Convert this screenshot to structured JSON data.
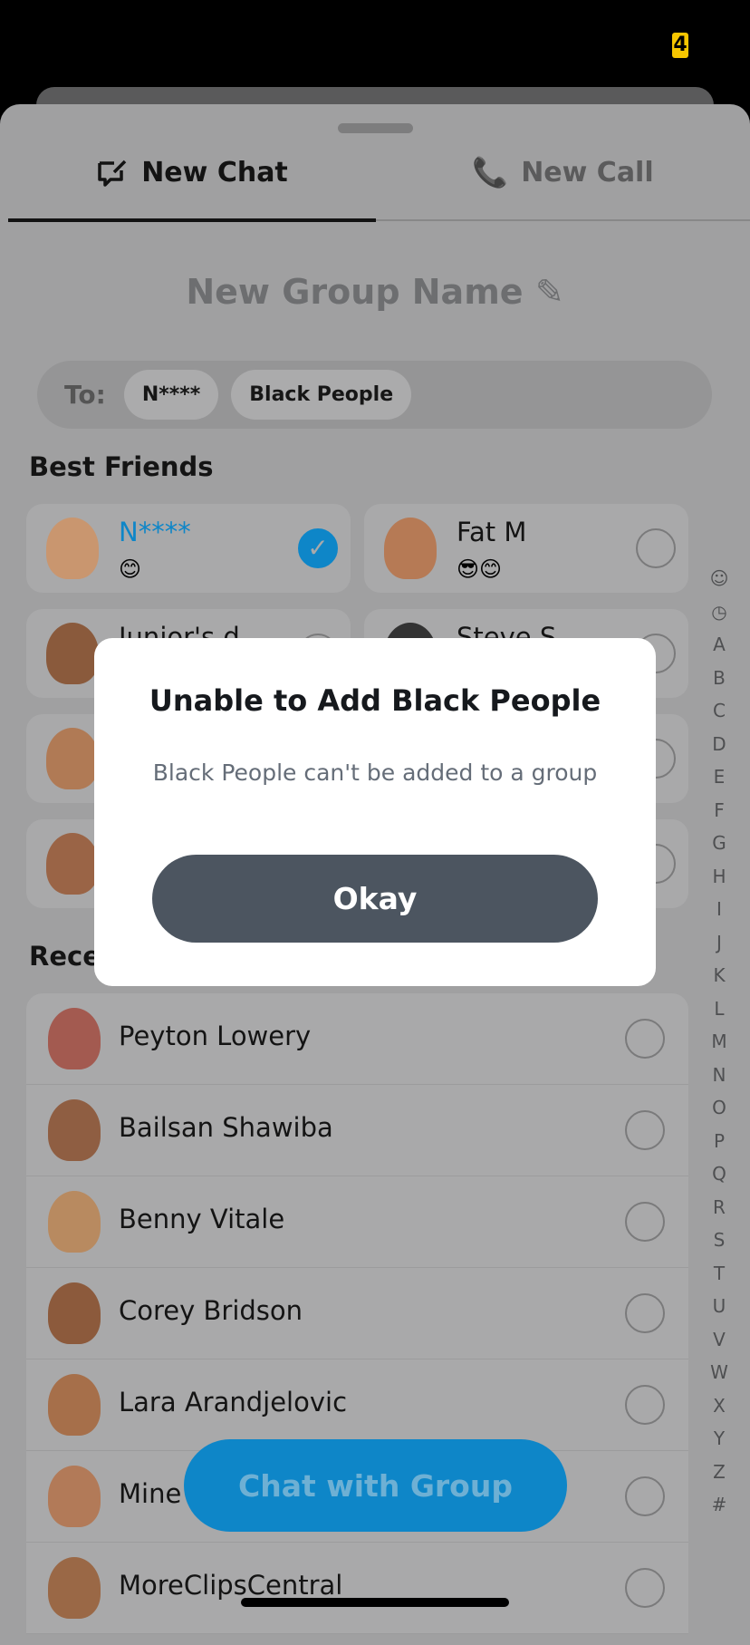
{
  "status_bar": {
    "badge": "4"
  },
  "tabs": [
    {
      "label": "New Chat",
      "icon": "new-chat-icon",
      "active": true
    },
    {
      "label": "New Call",
      "icon": "phone-icon",
      "active": false
    }
  ],
  "group_name": {
    "placeholder": "New Group Name",
    "icon": "pencil-icon"
  },
  "to_bar": {
    "label": "To:",
    "chips": [
      "N****",
      "Black People"
    ]
  },
  "best_friends": {
    "title": "Best Friends",
    "items": [
      {
        "name": "N****",
        "emoji": "😊",
        "selected": true,
        "skin": "#c9966f"
      },
      {
        "name": "Fat M",
        "emoji": "😎😊",
        "selected": false,
        "skin": "#b67a55"
      },
      {
        "name": "Junior's d",
        "emoji": "",
        "selected": false,
        "skin": "#8a5a3c"
      },
      {
        "name": "Steve S",
        "emoji": "",
        "selected": false,
        "skin": "#333"
      },
      {
        "name": "",
        "emoji": "",
        "selected": false,
        "skin": "#b07a55"
      },
      {
        "name": "",
        "emoji": "",
        "selected": false,
        "skin": "#b07a55"
      },
      {
        "name": "",
        "emoji": "",
        "selected": false,
        "skin": "#9a6446"
      },
      {
        "name": "",
        "emoji": "",
        "selected": false,
        "skin": "#b07a55"
      }
    ]
  },
  "recents": {
    "title": "Recents",
    "items": [
      {
        "name": "Peyton Lowery",
        "skin": "#a35a50"
      },
      {
        "name": "Bailsan Shawiba",
        "skin": "#8f5e42"
      },
      {
        "name": "Benny Vitale",
        "skin": "#b88a60"
      },
      {
        "name": "Corey Bridson",
        "skin": "#8c5a3c"
      },
      {
        "name": "Lara Arandjelovic",
        "skin": "#a66f4a"
      },
      {
        "name": "Mine",
        "skin": "#b27a58"
      },
      {
        "name": "MoreClipsCentral",
        "skin": "#9a6846"
      }
    ]
  },
  "alphabet": [
    "☺",
    "◷",
    "A",
    "B",
    "C",
    "D",
    "E",
    "F",
    "G",
    "H",
    "I",
    "J",
    "K",
    "L",
    "M",
    "N",
    "O",
    "P",
    "Q",
    "R",
    "S",
    "T",
    "U",
    "V",
    "W",
    "X",
    "Y",
    "Z",
    "#"
  ],
  "chat_button": "Chat with Group",
  "dialog": {
    "title": "Unable to Add Black People",
    "message": "Black People can't be added to a group",
    "button": "Okay"
  },
  "colors": {
    "accent": "#0e86c8",
    "dialog_button": "#4c5560",
    "badge": "#f7c600"
  }
}
